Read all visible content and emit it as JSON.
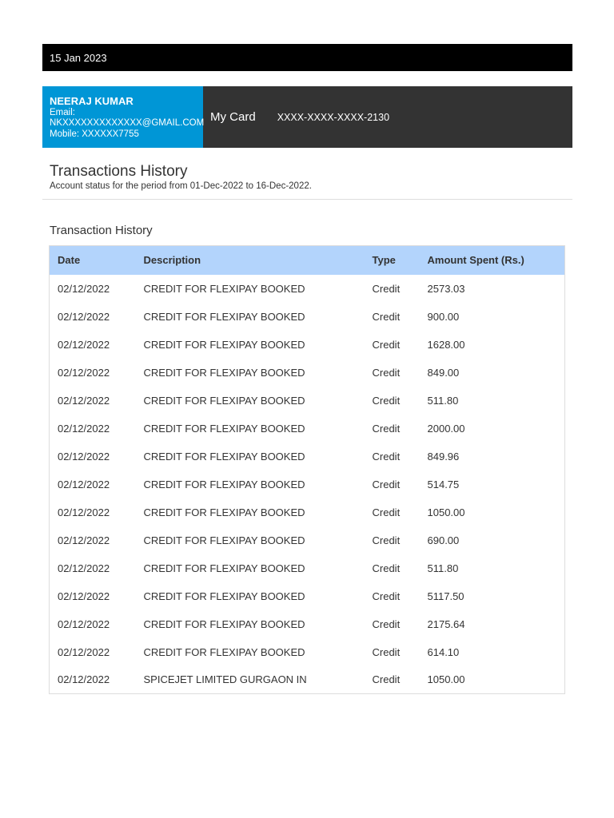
{
  "header": {
    "date": "15 Jan 2023"
  },
  "user": {
    "name": "NEERAJ KUMAR",
    "email_label": "Email:",
    "email": "NKXXXXXXXXXXXXX@GMAIL.COM",
    "mobile": "Mobile: XXXXXX7755"
  },
  "card": {
    "label": "My Card",
    "number": "XXXX-XXXX-XXXX-2130"
  },
  "page": {
    "title": "Transactions History",
    "subtitle": "Account status for the period from 01-Dec-2022 to 16-Dec-2022.",
    "section": "Transaction History"
  },
  "table": {
    "headers": [
      "Date",
      "Description",
      "Type",
      "Amount Spent (Rs.)"
    ],
    "rows": [
      [
        "02/12/2022",
        "CREDIT FOR FLEXIPAY BOOKED",
        "Credit",
        "2573.03"
      ],
      [
        "02/12/2022",
        "CREDIT FOR FLEXIPAY BOOKED",
        "Credit",
        "900.00"
      ],
      [
        "02/12/2022",
        "CREDIT FOR FLEXIPAY BOOKED",
        "Credit",
        "1628.00"
      ],
      [
        "02/12/2022",
        "CREDIT FOR FLEXIPAY BOOKED",
        "Credit",
        "849.00"
      ],
      [
        "02/12/2022",
        "CREDIT FOR FLEXIPAY BOOKED",
        "Credit",
        "511.80"
      ],
      [
        "02/12/2022",
        "CREDIT FOR FLEXIPAY BOOKED",
        "Credit",
        "2000.00"
      ],
      [
        "02/12/2022",
        "CREDIT FOR FLEXIPAY BOOKED",
        "Credit",
        "849.96"
      ],
      [
        "02/12/2022",
        "CREDIT FOR FLEXIPAY BOOKED",
        "Credit",
        "514.75"
      ],
      [
        "02/12/2022",
        "CREDIT FOR FLEXIPAY BOOKED",
        "Credit",
        "1050.00"
      ],
      [
        "02/12/2022",
        "CREDIT FOR FLEXIPAY BOOKED",
        "Credit",
        "690.00"
      ],
      [
        "02/12/2022",
        "CREDIT FOR FLEXIPAY BOOKED",
        "Credit",
        "511.80"
      ],
      [
        "02/12/2022",
        "CREDIT FOR FLEXIPAY BOOKED",
        "Credit",
        "5117.50"
      ],
      [
        "02/12/2022",
        "CREDIT FOR FLEXIPAY BOOKED",
        "Credit",
        "2175.64"
      ],
      [
        "02/12/2022",
        "CREDIT FOR FLEXIPAY BOOKED",
        "Credit",
        "614.10"
      ],
      [
        "02/12/2022",
        "SPICEJET LIMITED GURGAON IN",
        "Credit",
        "1050.00"
      ]
    ]
  }
}
